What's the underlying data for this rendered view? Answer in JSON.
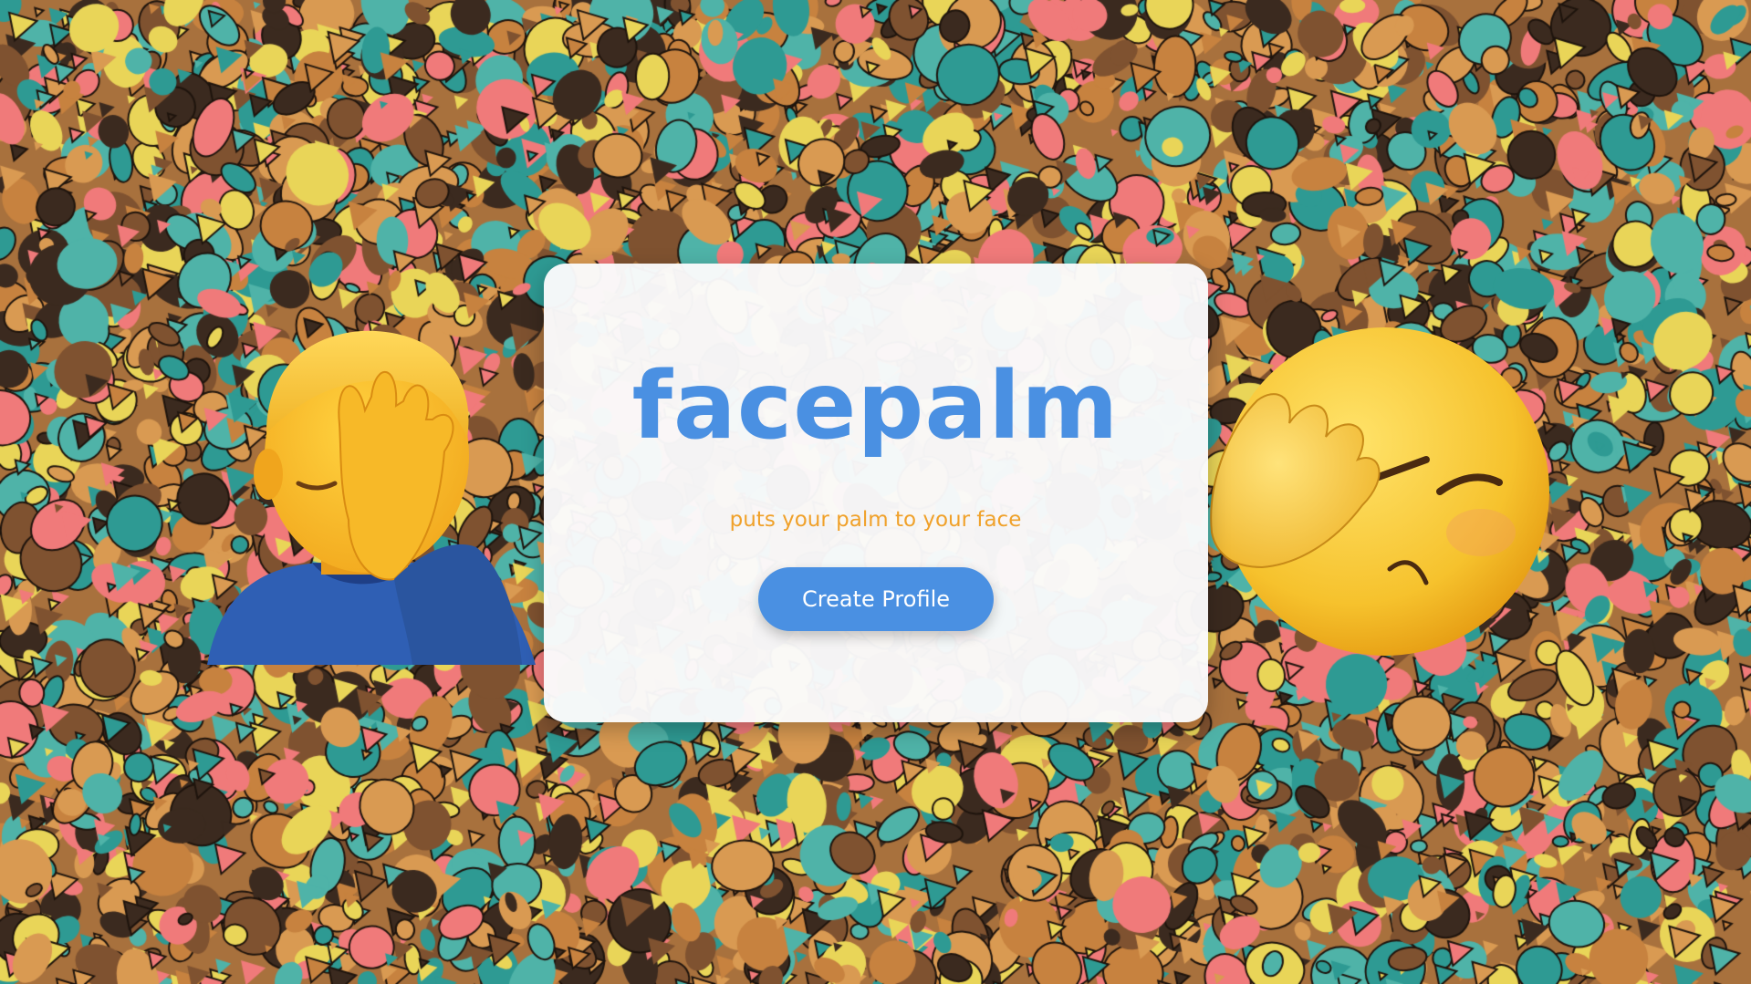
{
  "hero": {
    "title": "facepalm",
    "subtitle": "puts your palm to your face",
    "cta_label": "Create Profile"
  },
  "colors": {
    "accent": "#4a90e2",
    "subtitle": "#f0a12a",
    "card": "#fafafb"
  },
  "decorations": {
    "left_emoji": "person-facepalming-icon",
    "right_emoji": "face-palm-icon",
    "background": "tiled-cartoon-character-pattern"
  }
}
